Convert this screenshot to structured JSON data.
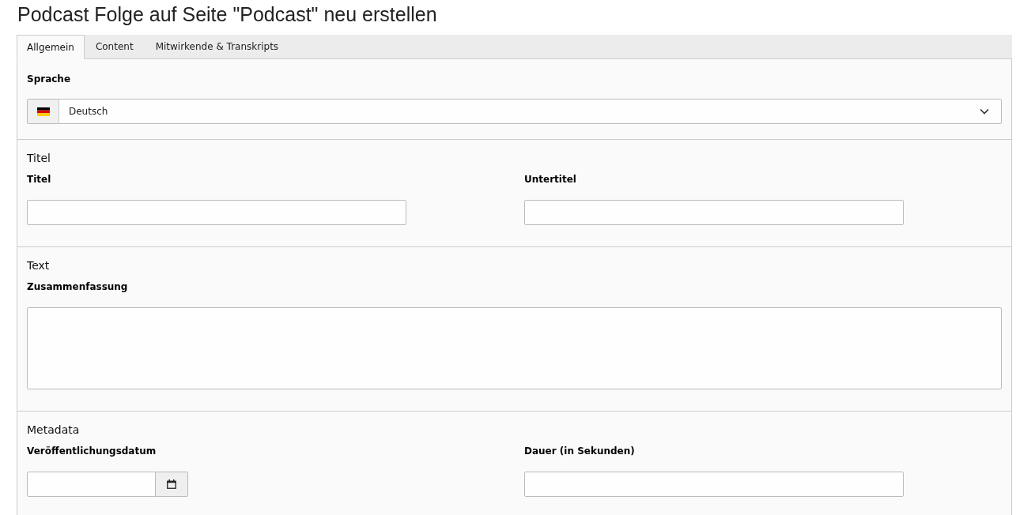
{
  "page_title": "Podcast Folge auf Seite \"Podcast\" neu erstellen",
  "tabs": [
    {
      "label": "Allgemein",
      "selected": true
    },
    {
      "label": "Content",
      "selected": false
    },
    {
      "label": "Mitwirkende & Transkripts",
      "selected": false
    }
  ],
  "sections": [
    {
      "fields": [
        {
          "kind": "select",
          "label": "Sprache",
          "value": "Deutsch"
        }
      ]
    },
    {
      "heading": "Titel",
      "fields": [
        {
          "kind": "text",
          "label": "Titel"
        },
        {
          "kind": "text",
          "label": "Untertitel"
        }
      ]
    },
    {
      "heading": "Text",
      "fields": [
        {
          "kind": "textarea",
          "label": "Zusammenfassung"
        }
      ]
    },
    {
      "heading": "Metadata",
      "fields": [
        {
          "kind": "date",
          "label": "Veröffentlichungsdatum"
        },
        {
          "kind": "text",
          "label": "Dauer (in Sekunden)"
        }
      ]
    }
  ]
}
